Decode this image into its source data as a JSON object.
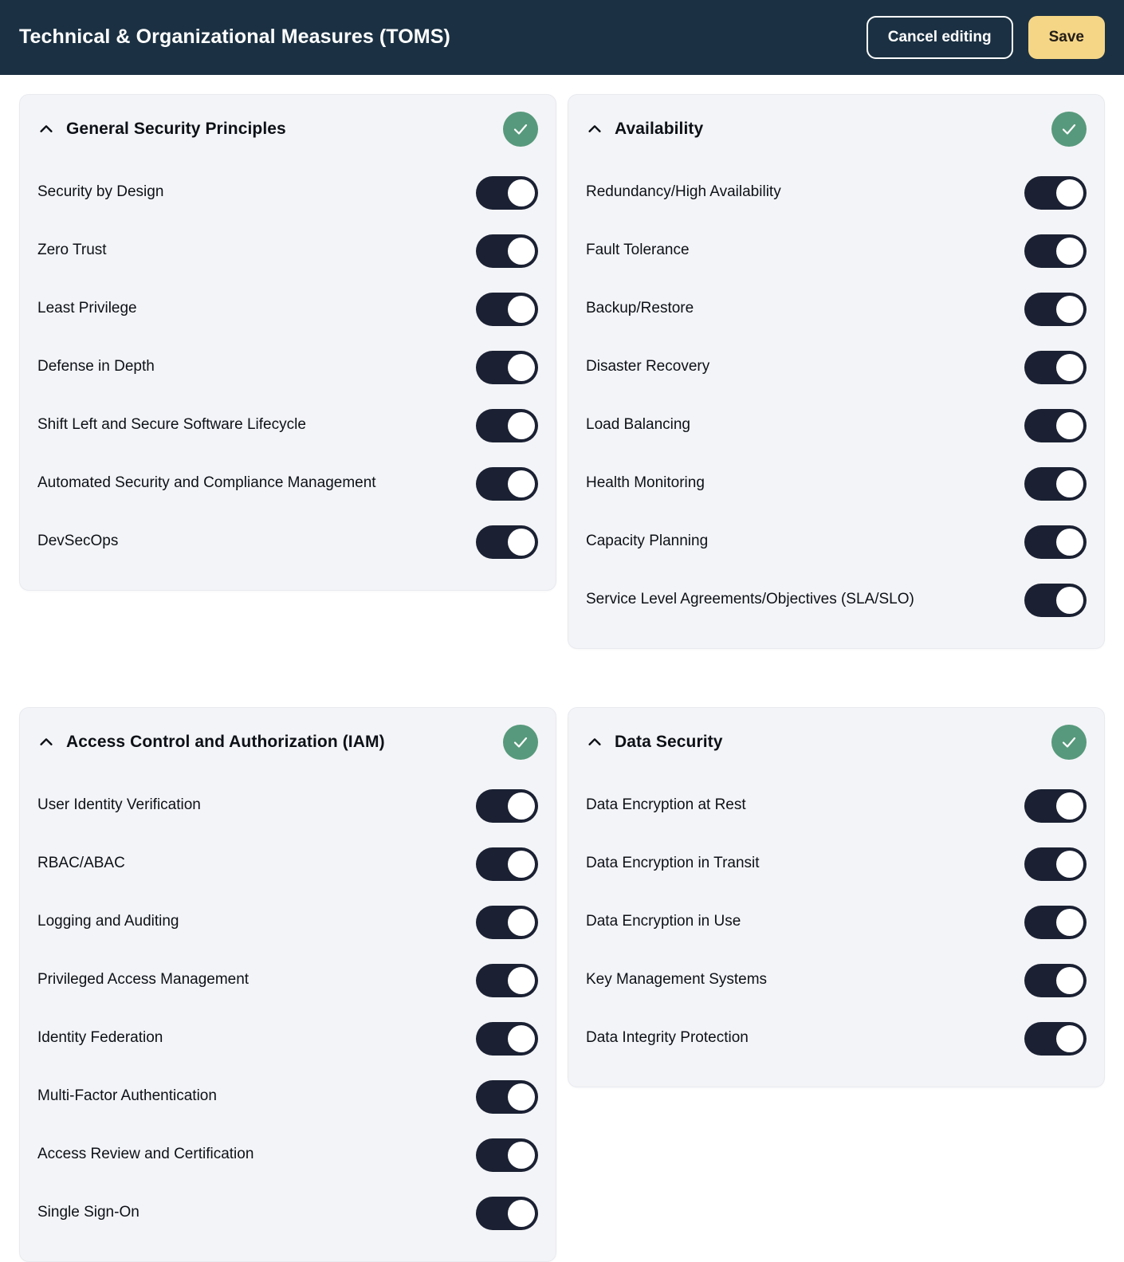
{
  "header": {
    "title": "Technical & Organizational Measures (TOMS)",
    "cancel_label": "Cancel editing",
    "save_label": "Save",
    "bar_color": "#1b3143",
    "save_color": "#f5d687"
  },
  "theme": {
    "page_background": "#ffffff",
    "card_background": "#f3f4f7",
    "card_border": "#e8eaef",
    "toggle_on_color": "#1b2133",
    "badge_green": "#57997c",
    "text_color": "#0d1117"
  },
  "icons": {
    "collapse": "chevron-up-icon",
    "complete": "check-circle-icon"
  },
  "cards": [
    {
      "id": "general-security-principles",
      "title": "General Security Principles",
      "complete": true,
      "items": [
        {
          "label": "Security by Design",
          "enabled": true
        },
        {
          "label": "Zero Trust",
          "enabled": true
        },
        {
          "label": "Least Privilege",
          "enabled": true
        },
        {
          "label": "Defense in Depth",
          "enabled": true
        },
        {
          "label": "Shift Left and Secure Software Lifecycle",
          "enabled": true
        },
        {
          "label": "Automated Security and Compliance Management",
          "enabled": true
        },
        {
          "label": "DevSecOps",
          "enabled": true
        }
      ]
    },
    {
      "id": "availability",
      "title": "Availability",
      "complete": true,
      "items": [
        {
          "label": "Redundancy/High Availability",
          "enabled": true
        },
        {
          "label": "Fault Tolerance",
          "enabled": true
        },
        {
          "label": "Backup/Restore",
          "enabled": true
        },
        {
          "label": "Disaster Recovery",
          "enabled": true
        },
        {
          "label": "Load Balancing",
          "enabled": true
        },
        {
          "label": "Health Monitoring",
          "enabled": true
        },
        {
          "label": "Capacity Planning",
          "enabled": true
        },
        {
          "label": "Service Level Agreements/Objectives (SLA/SLO)",
          "enabled": true
        }
      ]
    },
    {
      "id": "access-control-and-authorization-iam",
      "title": "Access Control and Authorization (IAM)",
      "complete": true,
      "items": [
        {
          "label": "User Identity Verification",
          "enabled": true
        },
        {
          "label": "RBAC/ABAC",
          "enabled": true
        },
        {
          "label": "Logging and Auditing",
          "enabled": true
        },
        {
          "label": "Privileged Access Management",
          "enabled": true
        },
        {
          "label": "Identity Federation",
          "enabled": true
        },
        {
          "label": "Multi-Factor Authentication",
          "enabled": true
        },
        {
          "label": "Access Review and Certification",
          "enabled": true
        },
        {
          "label": "Single Sign-On",
          "enabled": true
        }
      ]
    },
    {
      "id": "data-security",
      "title": "Data Security",
      "complete": true,
      "items": [
        {
          "label": "Data Encryption at Rest",
          "enabled": true
        },
        {
          "label": "Data Encryption in Transit",
          "enabled": true
        },
        {
          "label": "Data Encryption in Use",
          "enabled": true
        },
        {
          "label": "Key Management Systems",
          "enabled": true
        },
        {
          "label": "Data Integrity Protection",
          "enabled": true
        }
      ]
    }
  ]
}
